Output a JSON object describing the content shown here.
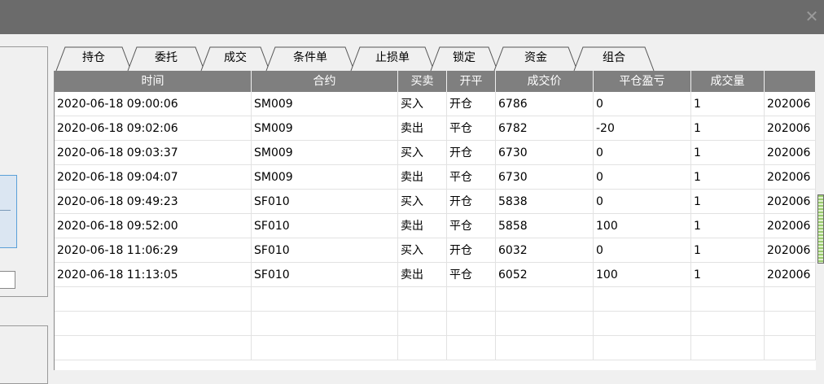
{
  "window": {
    "close_glyph": "✕"
  },
  "tabs": [
    {
      "label": "持仓"
    },
    {
      "label": "委托"
    },
    {
      "label": "成交",
      "active": true
    },
    {
      "label": "条件单"
    },
    {
      "label": "止损单"
    },
    {
      "label": "锁定"
    },
    {
      "label": "资金"
    },
    {
      "label": "组合"
    }
  ],
  "table": {
    "columns": [
      "时间",
      "合约",
      "买卖",
      "开平",
      "成交价",
      "平仓盈亏",
      "成交量",
      ""
    ],
    "rows": [
      [
        "2020-06-18 09:00:06",
        "SM009",
        "买入",
        "开仓",
        "6786",
        "0",
        "1",
        "202006"
      ],
      [
        "2020-06-18 09:02:06",
        "SM009",
        "卖出",
        "平仓",
        "6782",
        "-20",
        "1",
        "202006"
      ],
      [
        "2020-06-18 09:03:37",
        "SM009",
        "买入",
        "开仓",
        "6730",
        "0",
        "1",
        "202006"
      ],
      [
        "2020-06-18 09:04:07",
        "SM009",
        "卖出",
        "平仓",
        "6730",
        "0",
        "1",
        "202006"
      ],
      [
        "2020-06-18 09:49:23",
        "SF010",
        "买入",
        "开仓",
        "5838",
        "0",
        "1",
        "202006"
      ],
      [
        "2020-06-18 09:52:00",
        "SF010",
        "卖出",
        "平仓",
        "5858",
        "100",
        "1",
        "202006"
      ],
      [
        "2020-06-18 11:06:29",
        "SF010",
        "买入",
        "开仓",
        "6032",
        "0",
        "1",
        "202006"
      ],
      [
        "2020-06-18 11:13:05",
        "SF010",
        "卖出",
        "平仓",
        "6052",
        "100",
        "1",
        "202006"
      ]
    ],
    "empty_rows": 3
  },
  "colors": {
    "titlebar": "#6b6b6b",
    "header": "#7f7f7f",
    "grid_line": "#e2e2e2",
    "scroll_thumb": "#9acb6e"
  }
}
